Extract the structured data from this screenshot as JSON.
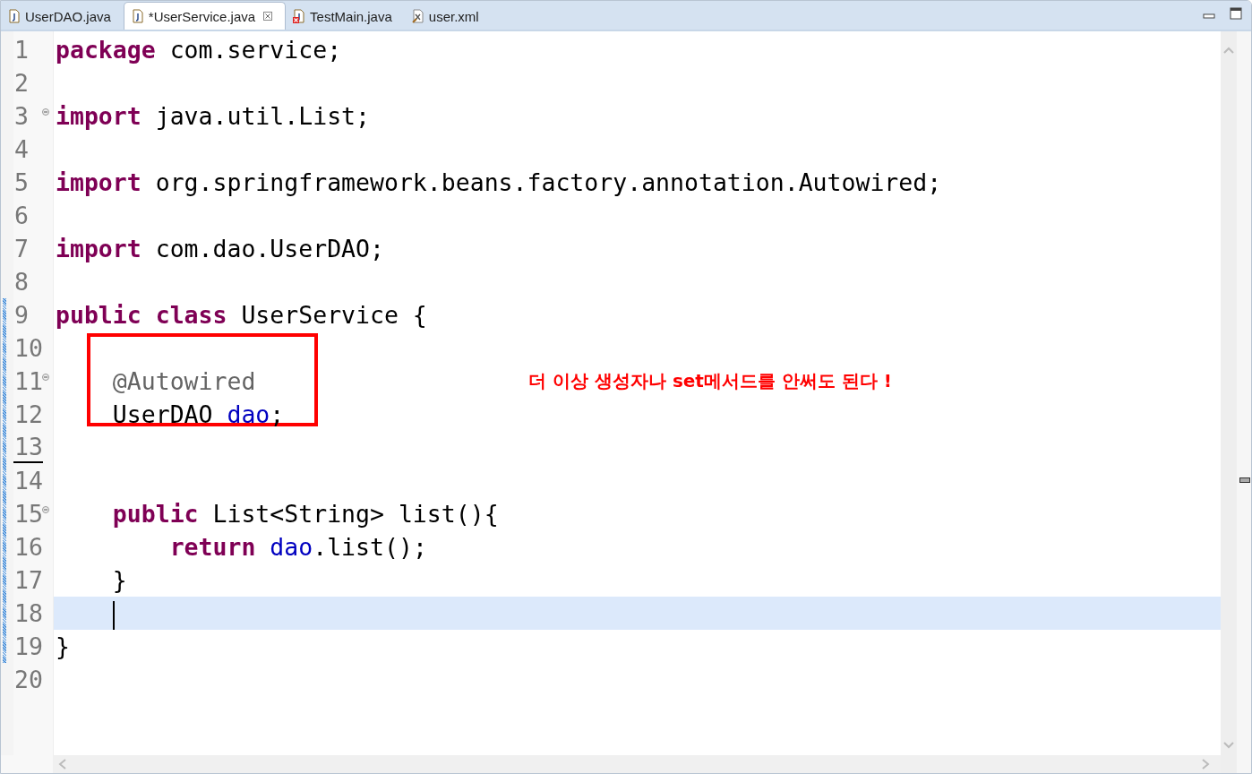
{
  "tabs": [
    {
      "label": "UserDAO.java",
      "kind": "java",
      "selected": false
    },
    {
      "label": "*UserService.java",
      "kind": "java",
      "selected": true
    },
    {
      "label": "TestMain.java",
      "kind": "java-error",
      "selected": false
    },
    {
      "label": "user.xml",
      "kind": "xml",
      "selected": false
    }
  ],
  "editor": {
    "lines": [
      {
        "number": "1",
        "changed": false,
        "fold": false,
        "current": false,
        "underlined": false,
        "tokens": [
          {
            "kind": "keyword",
            "text": "package"
          },
          {
            "kind": "plain",
            "text": " com.service;"
          }
        ]
      },
      {
        "number": "2",
        "changed": false,
        "fold": false,
        "current": false,
        "underlined": false
      },
      {
        "number": "3",
        "changed": false,
        "fold": true,
        "current": false,
        "underlined": false,
        "tokens": [
          {
            "kind": "keyword",
            "text": "import"
          },
          {
            "kind": "plain",
            "text": " java.util.List;"
          }
        ]
      },
      {
        "number": "4",
        "changed": false,
        "fold": false,
        "current": false,
        "underlined": false
      },
      {
        "number": "5",
        "changed": false,
        "fold": false,
        "current": false,
        "underlined": false,
        "tokens": [
          {
            "kind": "keyword",
            "text": "import"
          },
          {
            "kind": "plain",
            "text": " org.springframework.beans.factory.annotation.Autowired;"
          }
        ]
      },
      {
        "number": "6",
        "changed": false,
        "fold": false,
        "current": false,
        "underlined": false
      },
      {
        "number": "7",
        "changed": false,
        "fold": false,
        "current": false,
        "underlined": false,
        "tokens": [
          {
            "kind": "keyword",
            "text": "import"
          },
          {
            "kind": "plain",
            "text": " com.dao.UserDAO;"
          }
        ]
      },
      {
        "number": "8",
        "changed": false,
        "fold": false,
        "current": false,
        "underlined": false
      },
      {
        "number": "9",
        "changed": true,
        "fold": false,
        "current": false,
        "underlined": false,
        "tokens": [
          {
            "kind": "keyword",
            "text": "public class"
          },
          {
            "kind": "plain",
            "text": " UserService {"
          }
        ]
      },
      {
        "number": "10",
        "changed": true,
        "fold": false,
        "current": false,
        "underlined": false
      },
      {
        "number": "11",
        "changed": true,
        "fold": true,
        "current": false,
        "underlined": false,
        "tokens": [
          {
            "kind": "annotation",
            "text": "    @Autowired"
          }
        ]
      },
      {
        "number": "12",
        "changed": true,
        "fold": false,
        "current": false,
        "underlined": false,
        "tokens": [
          {
            "kind": "plain",
            "text": "    UserDAO "
          },
          {
            "kind": "field",
            "text": "dao"
          },
          {
            "kind": "plain",
            "text": ";"
          }
        ]
      },
      {
        "number": "13",
        "changed": true,
        "fold": false,
        "current": false,
        "underlined": true
      },
      {
        "number": "14",
        "changed": true,
        "fold": false,
        "current": false,
        "underlined": false
      },
      {
        "number": "15",
        "changed": true,
        "fold": true,
        "current": false,
        "underlined": false,
        "tokens": [
          {
            "kind": "keyword",
            "text": "    public"
          },
          {
            "kind": "plain",
            "text": " List<String> list(){"
          }
        ]
      },
      {
        "number": "16",
        "changed": true,
        "fold": false,
        "current": false,
        "underlined": false,
        "tokens": [
          {
            "kind": "keyword",
            "text": "        return "
          },
          {
            "kind": "field",
            "text": "dao"
          },
          {
            "kind": "plain",
            "text": ".list();"
          }
        ]
      },
      {
        "number": "17",
        "changed": true,
        "fold": false,
        "current": false,
        "underlined": false,
        "tokens": [
          {
            "kind": "plain",
            "text": "    }"
          }
        ]
      },
      {
        "number": "18",
        "changed": true,
        "fold": false,
        "current": true,
        "underlined": false
      },
      {
        "number": "19",
        "changed": true,
        "fold": false,
        "current": false,
        "underlined": false,
        "tokens": [
          {
            "kind": "plain",
            "text": "}"
          }
        ]
      },
      {
        "number": "20",
        "changed": false,
        "fold": false,
        "current": false,
        "underlined": false
      }
    ],
    "note": "더 이상 생성자나 set메서드를 안써도 된다 !"
  }
}
